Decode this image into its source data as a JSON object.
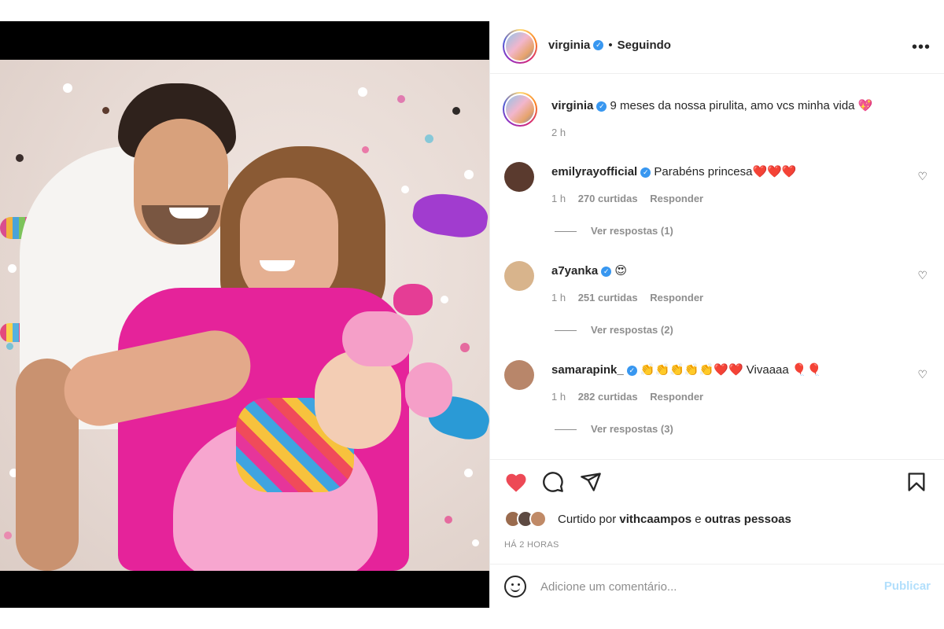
{
  "post": {
    "username": "virginia",
    "follow_status": "Seguindo",
    "more_label": "•••"
  },
  "caption": {
    "username": "virginia",
    "text": "9 meses da nossa pirulita, amo vcs minha vida 💖",
    "time": "2 h"
  },
  "comments": [
    {
      "username": "emilyrayofficial",
      "text": "Parabéns princesa❤️❤️❤️",
      "time": "1 h",
      "likes": "270 curtidas",
      "reply_label": "Responder",
      "view_replies": "Ver respostas (1)",
      "avatar_color": "#5a3a2e"
    },
    {
      "username": "a7yanka",
      "text": "😍",
      "time": "1 h",
      "likes": "251 curtidas",
      "reply_label": "Responder",
      "view_replies": "Ver respostas (2)",
      "avatar_color": "#d8b48c"
    },
    {
      "username": "samarapink_",
      "text": "👏👏👏👏👏❤️❤️ Vivaaaa 🎈🎈",
      "time": "1 h",
      "likes": "282 curtidas",
      "reply_label": "Responder",
      "view_replies": "Ver respostas (3)",
      "avatar_color": "#b8866a"
    }
  ],
  "actions": {
    "liked": true,
    "like_color": "#ed4956",
    "icons": [
      "heart-icon",
      "comment-icon",
      "share-icon",
      "bookmark-icon"
    ]
  },
  "likes_summary": {
    "prefix": "Curtido por",
    "user": "vithcaampos",
    "connector": "e",
    "others": "outras pessoas"
  },
  "timestamp": "HÁ 2 HORAS",
  "add_comment": {
    "placeholder": "Adicione um comentário...",
    "publish_label": "Publicar"
  },
  "colors": {
    "text": "#262626",
    "secondary": "#8e8e8e",
    "verified": "#3897f0",
    "publish_disabled": "#b2dffc"
  }
}
